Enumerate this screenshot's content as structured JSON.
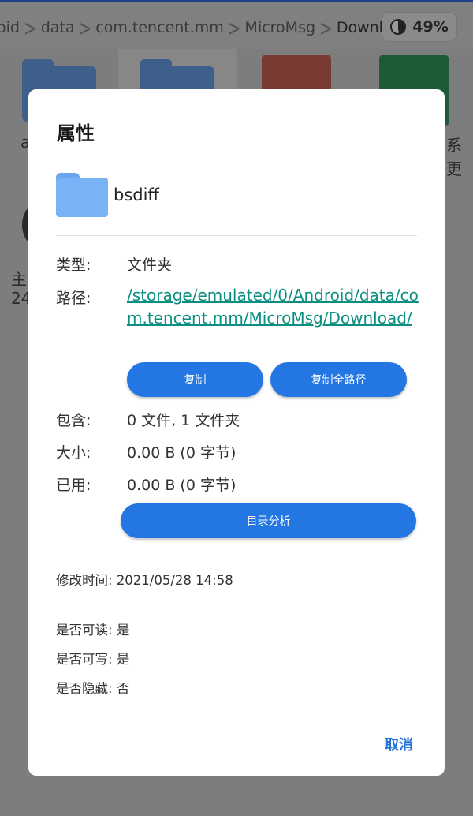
{
  "background": {
    "breadcrumbs": [
      "oid",
      "data",
      "com.tencent.mm",
      "MicroMsg",
      "Download"
    ],
    "storage_percent": "49%",
    "partial_texts": {
      "left_a": "a",
      "right_1": "系",
      "right_2": "更",
      "left_main": "主",
      "left_num": "24"
    }
  },
  "dialog": {
    "title": "属性",
    "file_name": "bsdiff",
    "type_label": "类型:",
    "type_value": "文件夹",
    "path_label": "路径:",
    "path_value": "/storage/emulated/0/Android/data/com.tencent.mm/MicroMsg/Download/",
    "copy_button": "复制",
    "copy_full_path_button": "复制全路径",
    "contains_label": "包含:",
    "contains_value": "0 文件, 1 文件夹",
    "size_label": "大小:",
    "size_value": "0.00 B (0 字节)",
    "used_label": "已用:",
    "used_value": "0.00 B (0 字节)",
    "analyze_button": "目录分析",
    "modified_label": "修改时间:",
    "modified_value": "2021/05/28 14:58",
    "readable_label": "是否可读:",
    "readable_value": "是",
    "writable_label": "是否可写:",
    "writable_value": "是",
    "hidden_label": "是否隐藏:",
    "hidden_value": "否",
    "cancel_button": "取消"
  },
  "colors": {
    "accent": "#2477e3",
    "link": "#0a8f80",
    "folder": "#7ab3f5"
  }
}
